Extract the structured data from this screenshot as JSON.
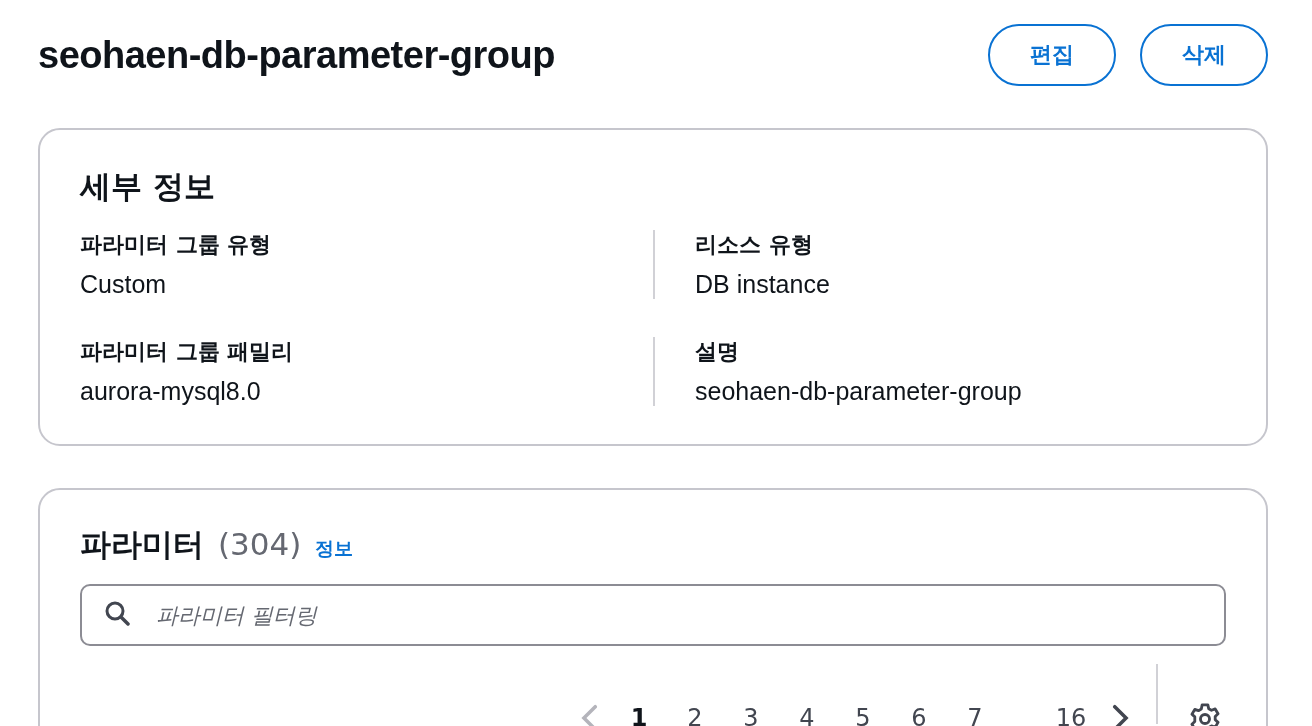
{
  "header": {
    "title": "seohaen-db-parameter-group",
    "buttons": [
      "편집",
      "삭제"
    ]
  },
  "details": {
    "heading": "세부 정보",
    "fields": [
      {
        "label": "파라미터 그룹 유형",
        "value": "Custom"
      },
      {
        "label": "리소스 유형",
        "value": "DB instance"
      },
      {
        "label": "파라미터 그룹 패밀리",
        "value": "aurora-mysql8.0"
      },
      {
        "label": "설명",
        "value": "seohaen-db-parameter-group"
      }
    ]
  },
  "parameters": {
    "heading": "파라미터",
    "count": "(304)",
    "info_link": "정보",
    "search": {
      "placeholder": "파라미터 필터링"
    },
    "pagination": {
      "prev_disabled": true,
      "next_disabled": false,
      "pages": [
        {
          "label": "1",
          "selected": true
        },
        {
          "label": "2",
          "selected": false
        },
        {
          "label": "3",
          "selected": false
        },
        {
          "label": "4",
          "selected": false
        },
        {
          "label": "5",
          "selected": false
        },
        {
          "label": "6",
          "selected": false
        },
        {
          "label": "7",
          "selected": false
        },
        {
          "label": "16",
          "selected": false
        }
      ]
    }
  }
}
